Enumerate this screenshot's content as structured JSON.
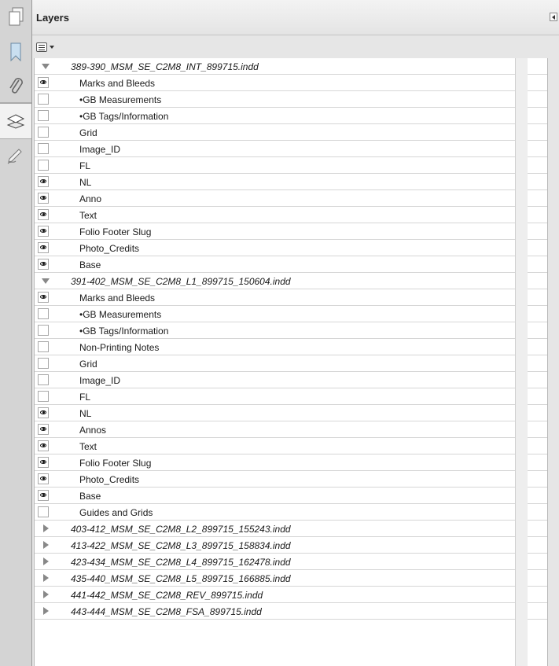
{
  "panel": {
    "title": "Layers"
  },
  "left_rail": {
    "buttons": [
      "pages-icon",
      "bookmarks-icon",
      "attachments-icon",
      "layers-icon",
      "signatures-icon"
    ],
    "active": "layers-icon"
  },
  "tree": {
    "groups": [
      {
        "file": "389-390_MSM_SE_C2M8_INT_899715.indd",
        "expanded": true,
        "layers": [
          {
            "name": "Marks and Bleeds",
            "visible": true
          },
          {
            "name": "•GB Measurements",
            "visible": false
          },
          {
            "name": "•GB Tags/Information",
            "visible": false
          },
          {
            "name": "Grid",
            "visible": false
          },
          {
            "name": "Image_ID",
            "visible": false
          },
          {
            "name": "FL",
            "visible": false
          },
          {
            "name": "NL",
            "visible": true
          },
          {
            "name": "Anno",
            "visible": true
          },
          {
            "name": "Text",
            "visible": true
          },
          {
            "name": "Folio Footer Slug",
            "visible": true
          },
          {
            "name": "Photo_Credits",
            "visible": true
          },
          {
            "name": "Base",
            "visible": true
          }
        ]
      },
      {
        "file": "391-402_MSM_SE_C2M8_L1_899715_150604.indd",
        "expanded": true,
        "layers": [
          {
            "name": "Marks and Bleeds",
            "visible": true
          },
          {
            "name": "•GB Measurements",
            "visible": false
          },
          {
            "name": "•GB Tags/Information",
            "visible": false
          },
          {
            "name": "Non-Printing Notes",
            "visible": false
          },
          {
            "name": "Grid",
            "visible": false
          },
          {
            "name": "Image_ID",
            "visible": false
          },
          {
            "name": "FL",
            "visible": false
          },
          {
            "name": "NL",
            "visible": true
          },
          {
            "name": "Annos",
            "visible": true
          },
          {
            "name": "Text",
            "visible": true
          },
          {
            "name": "Folio Footer Slug",
            "visible": true
          },
          {
            "name": "Photo_Credits",
            "visible": true
          },
          {
            "name": "Base",
            "visible": true
          },
          {
            "name": "Guides and Grids",
            "visible": false
          }
        ]
      },
      {
        "file": "403-412_MSM_SE_C2M8_L2_899715_155243.indd",
        "expanded": false,
        "layers": []
      },
      {
        "file": "413-422_MSM_SE_C2M8_L3_899715_158834.indd",
        "expanded": false,
        "layers": []
      },
      {
        "file": "423-434_MSM_SE_C2M8_L4_899715_162478.indd",
        "expanded": false,
        "layers": []
      },
      {
        "file": "435-440_MSM_SE_C2M8_L5_899715_166885.indd",
        "expanded": false,
        "layers": []
      },
      {
        "file": "441-442_MSM_SE_C2M8_REV_899715.indd",
        "expanded": false,
        "layers": []
      },
      {
        "file": "443-444_MSM_SE_C2M8_FSA_899715.indd",
        "expanded": false,
        "layers": []
      }
    ]
  }
}
